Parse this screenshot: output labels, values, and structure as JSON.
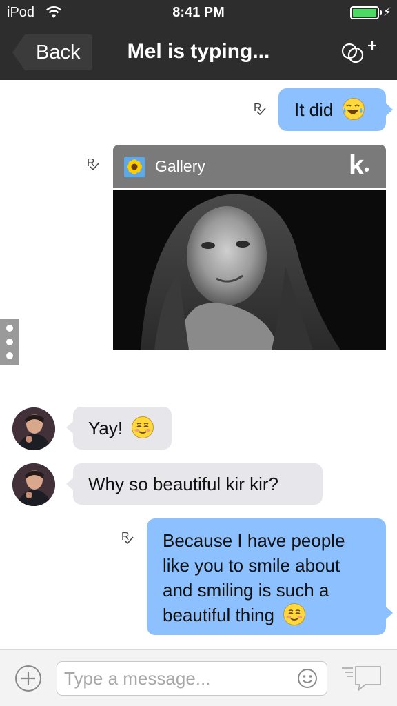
{
  "status_bar": {
    "carrier": "iPod",
    "time": "8:41 PM",
    "battery_level": 1.0
  },
  "nav": {
    "back_label": "Back",
    "title": "Mel is typing...",
    "group_icon": "add-people-icon"
  },
  "messages": [
    {
      "direction": "out",
      "text": "It did",
      "emoji": "tears-of-joy",
      "receipt": "R"
    },
    {
      "direction": "out",
      "type": "gallery",
      "card_label": "Gallery",
      "brand": "k",
      "receipt": "R"
    },
    {
      "direction": "in",
      "text": "Yay!",
      "emoji": "smiling-face"
    },
    {
      "direction": "in",
      "text": "Why so beautiful kir kir?"
    },
    {
      "direction": "out",
      "lines": [
        "Because I have people",
        "like you to smile about",
        "and smiling is such a",
        "beautiful thing"
      ],
      "emoji": "smiling-face",
      "receipt": "R"
    }
  ],
  "composer": {
    "placeholder": "Type a message..."
  },
  "colors": {
    "nav_bg": "#2d2d2d",
    "outgoing_bubble": "#8cc0ff",
    "incoming_bubble": "#e6e6eb",
    "battery": "#4cd964"
  }
}
